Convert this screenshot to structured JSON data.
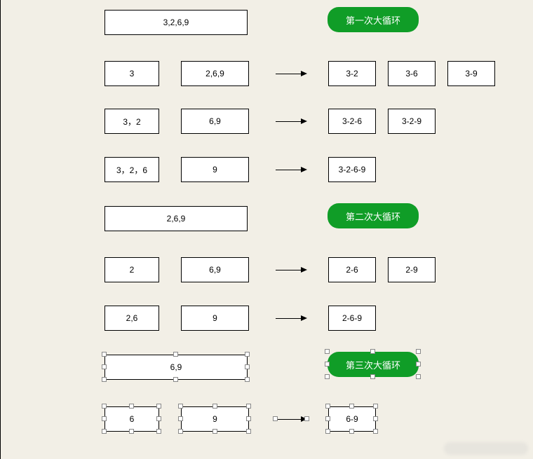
{
  "loops": [
    {
      "title": "第一次大循环",
      "header": "3,2,6,9",
      "rows": [
        {
          "left": "3",
          "right": "2,6,9",
          "results": [
            "3-2",
            "3-6",
            "3-9"
          ]
        },
        {
          "left": "3，2",
          "right": "6,9",
          "results": [
            "3-2-6",
            "3-2-9"
          ]
        },
        {
          "left": "3，2，6",
          "right": "9",
          "results": [
            "3-2-6-9"
          ]
        }
      ]
    },
    {
      "title": "第二次大循环",
      "header": "2,6,9",
      "rows": [
        {
          "left": "2",
          "right": "6,9",
          "results": [
            "2-6",
            "2-9"
          ]
        },
        {
          "left": "2,6",
          "right": "9",
          "results": [
            "2-6-9"
          ]
        }
      ]
    },
    {
      "title": "第三次大循环",
      "header": "6,9",
      "rows": [
        {
          "left": "6",
          "right": "9",
          "results": [
            "6-9"
          ]
        }
      ]
    }
  ],
  "colors": {
    "pill_bg": "#109d27",
    "page_bg": "#f2efe6"
  }
}
